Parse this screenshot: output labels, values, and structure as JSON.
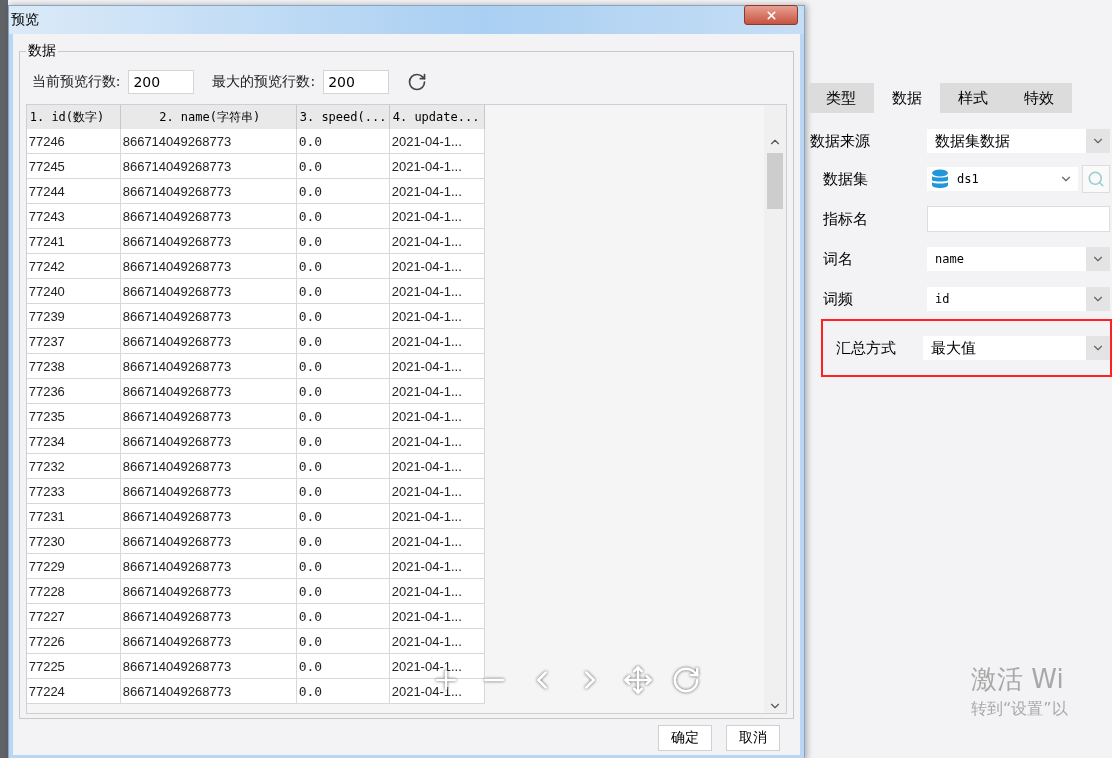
{
  "dialog": {
    "title": "预览",
    "group_title": "数据",
    "current_rows": {
      "label": "当前预览行数:",
      "value": "200"
    },
    "max_rows": {
      "label": "最大的预览行数:",
      "value": "200"
    },
    "table": {
      "columns": [
        "1. id(数字)",
        "2. name(字符串)",
        "3. speed(...",
        "4. update..."
      ],
      "rows": [
        [
          "77246",
          "866714049268773",
          "0.0",
          "2021-04-1..."
        ],
        [
          "77245",
          "866714049268773",
          "0.0",
          "2021-04-1..."
        ],
        [
          "77244",
          "866714049268773",
          "0.0",
          "2021-04-1..."
        ],
        [
          "77243",
          "866714049268773",
          "0.0",
          "2021-04-1..."
        ],
        [
          "77241",
          "866714049268773",
          "0.0",
          "2021-04-1..."
        ],
        [
          "77242",
          "866714049268773",
          "0.0",
          "2021-04-1..."
        ],
        [
          "77240",
          "866714049268773",
          "0.0",
          "2021-04-1..."
        ],
        [
          "77239",
          "866714049268773",
          "0.0",
          "2021-04-1..."
        ],
        [
          "77237",
          "866714049268773",
          "0.0",
          "2021-04-1..."
        ],
        [
          "77238",
          "866714049268773",
          "0.0",
          "2021-04-1..."
        ],
        [
          "77236",
          "866714049268773",
          "0.0",
          "2021-04-1..."
        ],
        [
          "77235",
          "866714049268773",
          "0.0",
          "2021-04-1..."
        ],
        [
          "77234",
          "866714049268773",
          "0.0",
          "2021-04-1..."
        ],
        [
          "77232",
          "866714049268773",
          "0.0",
          "2021-04-1..."
        ],
        [
          "77233",
          "866714049268773",
          "0.0",
          "2021-04-1..."
        ],
        [
          "77231",
          "866714049268773",
          "0.0",
          "2021-04-1..."
        ],
        [
          "77230",
          "866714049268773",
          "0.0",
          "2021-04-1..."
        ],
        [
          "77229",
          "866714049268773",
          "0.0",
          "2021-04-1..."
        ],
        [
          "77228",
          "866714049268773",
          "0.0",
          "2021-04-1..."
        ],
        [
          "77227",
          "866714049268773",
          "0.0",
          "2021-04-1..."
        ],
        [
          "77226",
          "866714049268773",
          "0.0",
          "2021-04-1..."
        ],
        [
          "77225",
          "866714049268773",
          "0.0",
          "2021-04-1..."
        ],
        [
          "77224",
          "866714049268773",
          "0.0",
          "2021-04-1..."
        ]
      ]
    },
    "buttons": [
      "确定",
      "取消"
    ]
  },
  "panel": {
    "tabs": [
      {
        "label": "类型",
        "selected": false
      },
      {
        "label": "数据",
        "selected": true
      },
      {
        "label": "样式",
        "selected": false
      },
      {
        "label": "特效",
        "selected": false
      }
    ],
    "fields": [
      {
        "kind": "select",
        "label": "数据来源",
        "value": "数据集数据",
        "highlighted": false
      },
      {
        "kind": "dataset",
        "label": "数据集",
        "value": "ds1",
        "highlighted": false
      },
      {
        "kind": "text",
        "label": "指标名",
        "highlighted": false
      },
      {
        "kind": "select",
        "label": "词名",
        "value": "name",
        "highlighted": false
      },
      {
        "kind": "select",
        "label": "词频",
        "value": "id",
        "highlighted": false
      },
      {
        "kind": "select",
        "label": "汇总方式",
        "value": "最大值",
        "highlighted": true
      }
    ]
  },
  "activation": {
    "title": "激活 Wi",
    "hint": "转到“设置”以"
  }
}
